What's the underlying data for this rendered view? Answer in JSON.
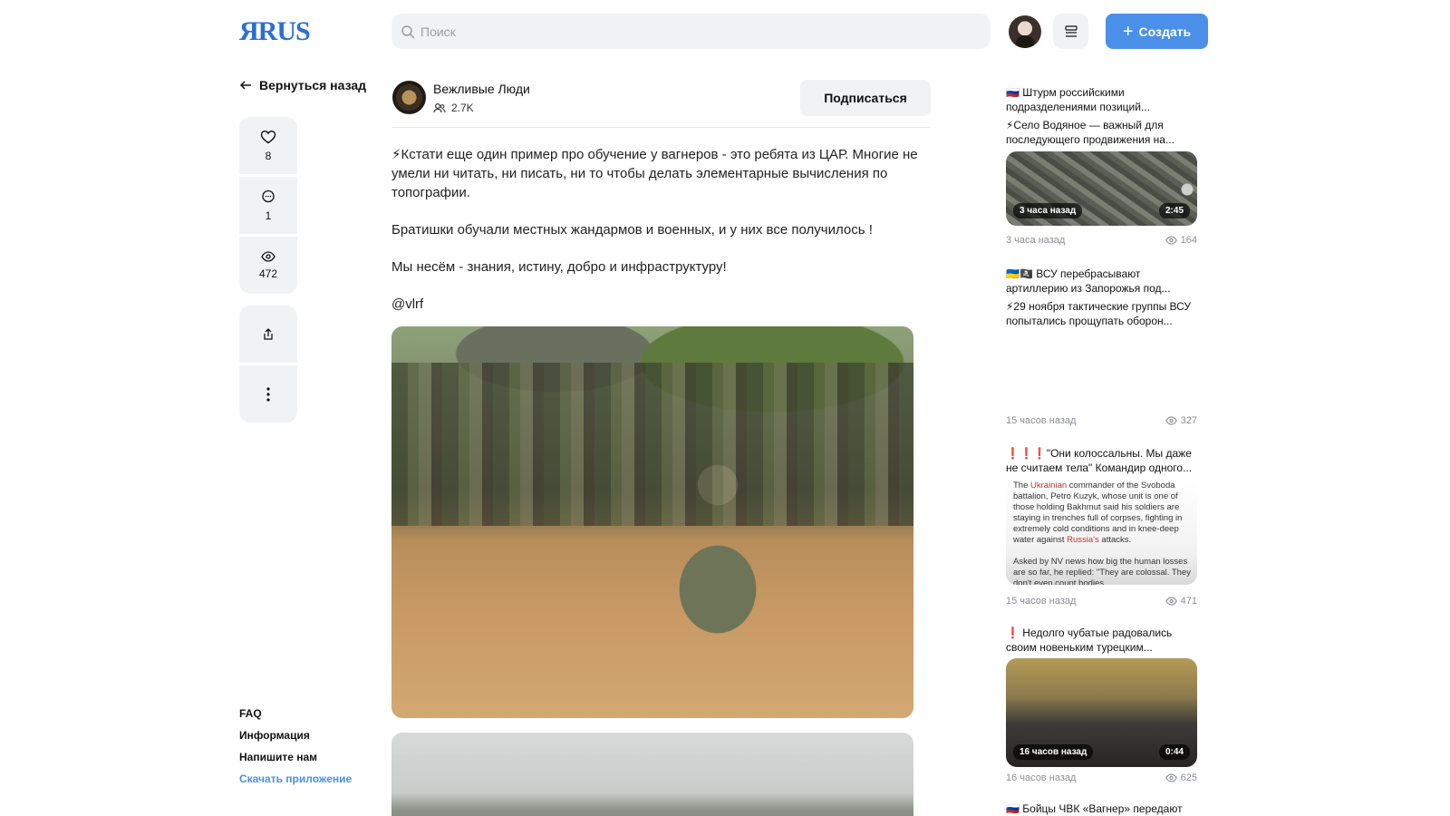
{
  "header": {
    "logo_prefix": "Я",
    "logo_suffix": "RUS",
    "search_placeholder": "Поиск",
    "create_label": "Создать"
  },
  "sidebar": {
    "back_label": "Вернуться назад",
    "likes": "8",
    "comments": "1",
    "views": "472",
    "footer": {
      "faq": "FAQ",
      "info": "Информация",
      "contact": "Напишите нам",
      "download": "Скачать приложение"
    }
  },
  "post": {
    "channel_name": "Вежливые Люди",
    "subscribers": "2.7K",
    "subscribe_label": "Подписаться",
    "paragraphs": [
      "⚡Кстати еще один пример про обучение у вагнеров - это ребята из ЦАР. Многие не умели ни читать, ни писать, ни то чтобы делать элементарные вычисления по топографии.",
      "Братишки обучали местных жандармов и военных, и у них все получилось !",
      "Мы несём - знания, истину, добро и инфраструктуру!",
      "@vlrf"
    ]
  },
  "feed": [
    {
      "line1": "🇷🇺 Штурм российскими подразделениями позиций...",
      "line2": "⚡Село Водяное — важный для последующего продвижения на...",
      "badge_time": "3 часа назад",
      "badge_duration": "2:45",
      "time": "3 часа назад",
      "views": "164"
    },
    {
      "line1": "🇺🇦🏴‍☠️ ВСУ перебрасывают артиллерию из Запорожья под...",
      "line2": "⚡29 ноября тактические группы ВСУ попытались прощупать оборон...",
      "time": "15 часов назад",
      "views": "327"
    },
    {
      "line1": "❗❗❗\"Они колоссальны. Мы даже не считаем тела\" Командир одного...",
      "article_p1_a": "The ",
      "article_p1_red": "Ukrainian",
      "article_p1_b": " commander of the Svoboda battalion, Petro Kuzyk, whose unit is one of those holding Bakhmut said his soldiers are staying in trenches full of corpses, fighting in extremely cold conditions and in knee-deep water against ",
      "article_p1_red2": "Russia's",
      "article_p1_c": " attacks.",
      "article_p2": "Asked by NV news how big the human losses are so far, he replied: \"They are colossal. They don't even count bodies.",
      "time": "15 часов назад",
      "views": "471"
    },
    {
      "line1": "❗ Недолго чубатые радовались своим новеньким турецким...",
      "badge_time": "16 часов назад",
      "badge_duration": "0:44",
      "time": "16 часов назад",
      "views": "625"
    },
    {
      "line1": "🇷🇺 Бойцы ЧВК «Вагнер» передают"
    }
  ]
}
